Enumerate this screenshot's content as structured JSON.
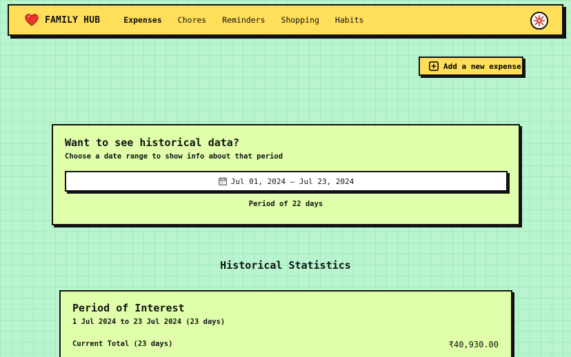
{
  "nav": {
    "brand": "FAMILY HUB",
    "brand_icon": "heart-icon",
    "links": [
      "Expenses",
      "Chores",
      "Reminders",
      "Shopping",
      "Habits"
    ],
    "active_link": "Expenses"
  },
  "actions": {
    "add_expense_label": "Add a new expense",
    "add_expense_icon": "plus-square-icon"
  },
  "history": {
    "title": "Want to see historical data?",
    "subtitle": "Choose a date range to show info about that period",
    "date_range": "Jul 01, 2024 – Jul 23, 2024",
    "date_icon": "calendar-icon",
    "period_text": "Period of 22 days"
  },
  "stats": {
    "heading": "Historical Statistics",
    "period_card": {
      "title": "Period of Interest",
      "range": "1 Jul 2024 to 23 Jul 2024 (23 days)",
      "total_label": "Current Total (23 days)",
      "total_value": "₹40,930.00"
    }
  },
  "colors": {
    "background": "#b8f5cf",
    "navbar": "#ffde5a",
    "card": "#e0ffaa",
    "border": "#111111",
    "heart": "#e8352b"
  }
}
